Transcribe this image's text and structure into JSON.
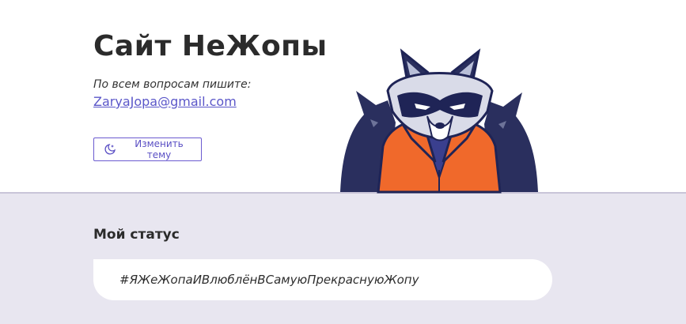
{
  "header": {
    "title": "Сайт НеЖопы",
    "contact_note": "По всем вопросам пишите:",
    "email": "ZaryaJopa@gmail.com",
    "theme_button_label": "Изменить тему",
    "theme_icon": "moon-stars-icon",
    "illustration": "raccoon-mascot"
  },
  "status": {
    "heading": "Мой статус",
    "text": "#ЯЖеЖопаИВлюблёнВСамуюПрекраснуюЖопу"
  },
  "colors": {
    "accent": "#5b57c9",
    "header_bg": "#ffffff",
    "page_bg": "#e8e6f0",
    "jacket_orange": "#f0692b",
    "navy": "#1f2456"
  }
}
